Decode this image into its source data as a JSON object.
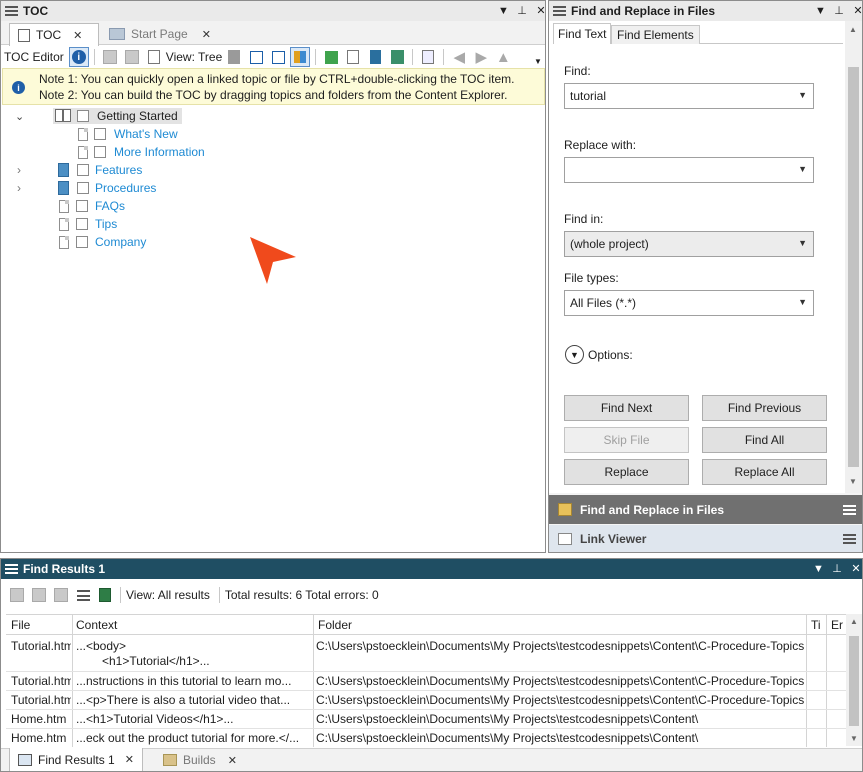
{
  "toc_window": {
    "title": "TOC",
    "tabs": [
      {
        "label": "TOC"
      },
      {
        "label": "Start Page"
      }
    ],
    "toolbar": {
      "editor_label": "TOC Editor",
      "view_label": "View: Tree"
    },
    "notes": [
      "Note 1: You can quickly open a linked topic or file by CTRL+double-clicking the TOC item.",
      "Note 2: You can build the TOC by dragging topics and folders from the Content Explorer."
    ],
    "tree": [
      {
        "label": "Getting Started"
      },
      {
        "label": "What's New"
      },
      {
        "label": "More Information"
      },
      {
        "label": "Features"
      },
      {
        "label": "Procedures"
      },
      {
        "label": "FAQs"
      },
      {
        "label": "Tips"
      },
      {
        "label": "Company"
      }
    ]
  },
  "find_replace": {
    "title": "Find and Replace in Files",
    "tabs": [
      {
        "label": "Find Text"
      },
      {
        "label": "Find Elements"
      }
    ],
    "find_label": "Find:",
    "find_value": "tutorial",
    "replace_label": "Replace with:",
    "replace_value": "",
    "find_in_label": "Find in:",
    "find_in_value": "(whole project)",
    "file_types_label": "File types:",
    "file_types_value": "All Files (*.*)",
    "options_label": "Options:",
    "buttons": {
      "find_next": "Find Next",
      "find_previous": "Find Previous",
      "skip_file": "Skip File",
      "find_all": "Find All",
      "replace": "Replace",
      "replace_all": "Replace All"
    },
    "collapsed_panels": [
      {
        "label": "Find and Replace in Files"
      },
      {
        "label": "Link Viewer"
      }
    ]
  },
  "find_results": {
    "title": "Find Results 1",
    "view_label": "View: All results",
    "totals": "Total results: 6 Total errors: 0",
    "columns": [
      "File",
      "Context",
      "Folder",
      "Ti",
      "Er"
    ],
    "rows": [
      {
        "file": "Tutorial.htm",
        "context": "...<body>",
        "context2": "<h1>Tutorial</h1>...",
        "folder": "C:\\Users\\pstoecklein\\Documents\\My Projects\\testcodesnippets\\Content\\C-Procedure-Topics"
      },
      {
        "file": "Tutorial.htm",
        "context": "...nstructions in this tutorial to learn mo...",
        "folder": "C:\\Users\\pstoecklein\\Documents\\My Projects\\testcodesnippets\\Content\\C-Procedure-Topics"
      },
      {
        "file": "Tutorial.htm",
        "context": "...<p>There is also a tutorial video that...",
        "folder": "C:\\Users\\pstoecklein\\Documents\\My Projects\\testcodesnippets\\Content\\C-Procedure-Topics"
      },
      {
        "file": "Home.htm",
        "context": "...<h1>Tutorial Videos</h1>...",
        "folder": "C:\\Users\\pstoecklein\\Documents\\My Projects\\testcodesnippets\\Content\\"
      },
      {
        "file": "Home.htm",
        "context": "...eck out the product tutorial for more.</...",
        "folder": "C:\\Users\\pstoecklein\\Documents\\My Projects\\testcodesnippets\\Content\\"
      }
    ],
    "bottom_tabs": [
      {
        "label": "Find Results 1"
      },
      {
        "label": "Builds"
      }
    ]
  },
  "colors": {
    "accent": "#1e8ad3",
    "results_title_bar": "#1f4e63",
    "collapsed_panel_dark": "#707070",
    "collapsed_panel_light": "#dfe6ee",
    "cursor": "#f04a1c"
  }
}
